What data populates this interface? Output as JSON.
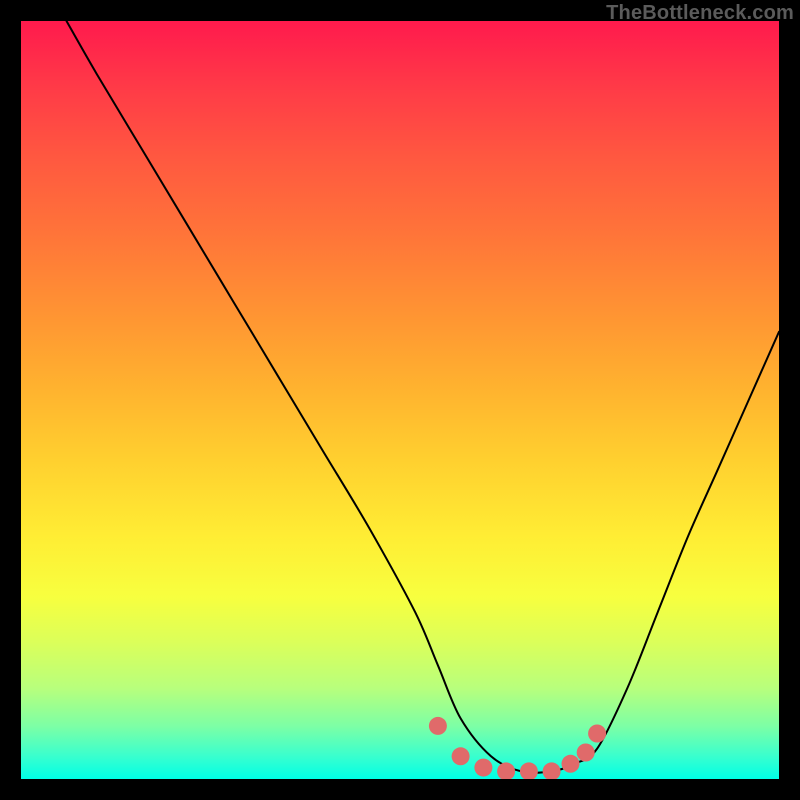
{
  "watermark_text": "TheBottleneck.com",
  "chart_data": {
    "type": "line",
    "title": "",
    "xlabel": "",
    "ylabel": "",
    "x_range": [
      0,
      100
    ],
    "y_range": [
      0,
      100
    ],
    "series": [
      {
        "name": "bottleneck-curve",
        "color": "#000000",
        "stroke_width": 2,
        "x": [
          6,
          10,
          16,
          22,
          28,
          34,
          40,
          46,
          52,
          55,
          58,
          62,
          66,
          70,
          73,
          76,
          80,
          84,
          88,
          92,
          96,
          100
        ],
        "y": [
          100,
          93,
          83,
          73,
          63,
          53,
          43,
          33,
          22,
          15,
          8,
          3,
          1,
          1,
          2,
          4,
          12,
          22,
          32,
          41,
          50,
          59
        ]
      }
    ],
    "markers": {
      "name": "flat-zone-dots",
      "color": "#e06a6a",
      "radius": 9,
      "points_x": [
        55,
        58,
        61,
        64,
        67,
        70,
        72.5,
        74.5,
        76
      ],
      "points_y": [
        7,
        3,
        1.5,
        1,
        1,
        1,
        2,
        3.5,
        6
      ]
    },
    "background_gradient": {
      "type": "vertical",
      "stops": [
        {
          "pos": 0.0,
          "color": "#ff1a4d"
        },
        {
          "pos": 0.28,
          "color": "#ff7439"
        },
        {
          "pos": 0.58,
          "color": "#ffd02f"
        },
        {
          "pos": 0.82,
          "color": "#dbff5a"
        },
        {
          "pos": 1.0,
          "color": "#00ffe6"
        }
      ]
    }
  }
}
